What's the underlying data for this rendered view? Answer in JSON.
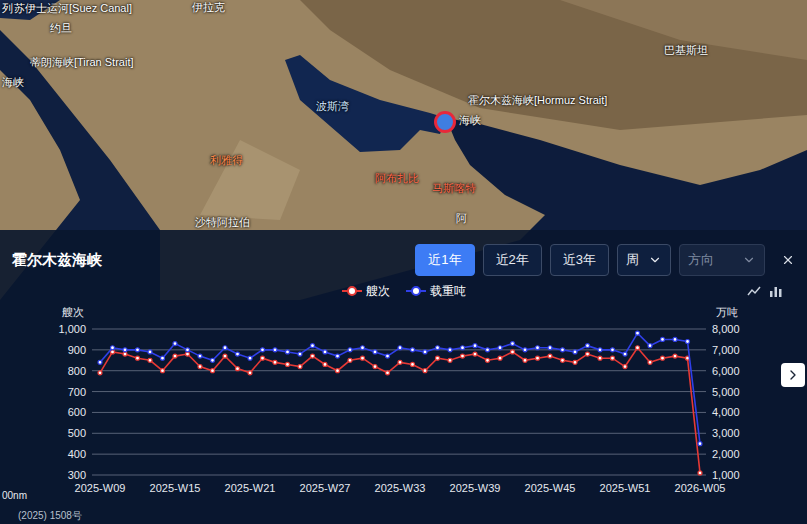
{
  "map": {
    "labels": [
      {
        "text": "列",
        "color": "#ffffff"
      },
      {
        "text": "苏伊士运河[Suez Canal]",
        "color": "#ffffff"
      },
      {
        "text": "伊拉克",
        "color": "#ffffff"
      },
      {
        "text": "约旦",
        "color": "#ffffff"
      },
      {
        "text": "蒂朗海峡[Tiran Strait]",
        "color": "#ffffff"
      },
      {
        "text": "海峡",
        "color": "#ffffff"
      },
      {
        "text": "波斯湾",
        "color": "#cfe6ff"
      },
      {
        "text": "霍尔木兹海峡[Hormuz Strait]",
        "color": "#ffffff"
      },
      {
        "text": "海峡",
        "color": "#ffffff"
      },
      {
        "text": "利雅得",
        "color": "#ff8a4c"
      },
      {
        "text": "阿布扎比",
        "color": "#ff6a4c"
      },
      {
        "text": "马斯喀特",
        "color": "#ff6a4c"
      },
      {
        "text": "巴基斯坦",
        "color": "#ffffff"
      },
      {
        "text": "沙特阿拉伯",
        "color": "#ffffff"
      },
      {
        "text": "阿",
        "color": "#ffffff"
      }
    ],
    "scale": "00nm",
    "credit": "(2025) 1508号"
  },
  "panel": {
    "title": "霍尔木兹海峡",
    "ranges": [
      {
        "label": "近1年",
        "selected": true
      },
      {
        "label": "近2年",
        "selected": false
      },
      {
        "label": "近3年",
        "selected": false
      }
    ],
    "period": {
      "value": "周"
    },
    "direction": {
      "placeholder": "方向",
      "disabled": true
    },
    "chart": {
      "legend": [
        {
          "label": "艘次",
          "color": "#e53935",
          "axis": "left",
          "values": [
            790,
            890,
            880,
            860,
            850,
            800,
            870,
            880,
            820,
            800,
            870,
            810,
            790,
            860,
            840,
            830,
            820,
            870,
            830,
            800,
            850,
            860,
            820,
            790,
            840,
            830,
            800,
            860,
            850,
            870,
            880,
            850,
            860,
            890,
            850,
            860,
            870,
            850,
            840,
            880,
            860,
            860,
            820,
            910,
            840,
            860,
            870,
            860,
            310
          ]
        },
        {
          "label": "载重吨",
          "color": "#2f3fe8",
          "axis": "right",
          "values": [
            6400,
            7100,
            7000,
            7000,
            6900,
            6600,
            7300,
            7000,
            6700,
            6500,
            7100,
            6800,
            6600,
            7000,
            7000,
            6900,
            6800,
            7200,
            6900,
            6700,
            7000,
            7100,
            6900,
            6700,
            7100,
            7000,
            6900,
            7100,
            7000,
            7100,
            7200,
            7000,
            7100,
            7300,
            7000,
            7100,
            7100,
            7000,
            6900,
            7200,
            7000,
            7000,
            6800,
            7800,
            7200,
            7500,
            7500,
            7400,
            2500
          ]
        }
      ],
      "left_axis": {
        "unit": "艘次",
        "ticks": [
          "1,000",
          "900",
          "800",
          "700",
          "600",
          "500",
          "400",
          "300"
        ],
        "max": 1000,
        "min": 300
      },
      "right_axis": {
        "unit": "万吨",
        "ticks": [
          "8,000",
          "7,000",
          "6,000",
          "5,000",
          "4,000",
          "3,000",
          "2,000",
          "1,000"
        ],
        "max": 8000,
        "min": 1000
      },
      "x_ticks": [
        "2025-W09",
        "2025-W15",
        "2025-W21",
        "2025-W27",
        "2025-W33",
        "2025-W39",
        "2025-W45",
        "2025-W51",
        "2026-W05"
      ]
    }
  }
}
